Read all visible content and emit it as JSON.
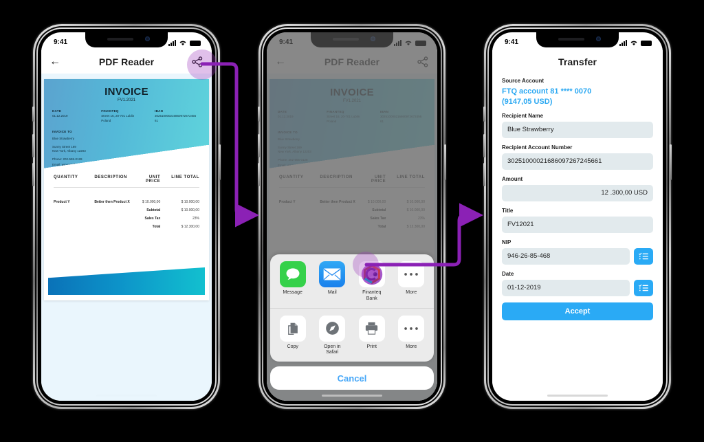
{
  "meta": {
    "accent_purple": "#8b21b5",
    "ios_blue": "#2aaaf5",
    "link_blue": "#48a8f8"
  },
  "status_bar": {
    "time": "9:41",
    "signal_icon": "cellular-bars-icon",
    "wifi_icon": "wifi-icon",
    "battery_icon": "battery-full-icon"
  },
  "phone1": {
    "navbar": {
      "back_icon": "back-arrow-icon",
      "title": "PDF Reader",
      "share_icon": "share-icon"
    },
    "invoice": {
      "title": "INVOICE",
      "number": "FV1.2021",
      "fields": [
        {
          "label": "DATE",
          "value": "01.12.2019"
        },
        {
          "label": "FINANTEQ",
          "value": "Street 16, 20-701 Lublin\nPoland"
        },
        {
          "label": "IBAN",
          "value": "30251000021686097267245661"
        }
      ],
      "invoice_to_label": "INVOICE TO",
      "invoice_to": "Blue Strawberry",
      "address": "Sunny Street 169\nNew York, Albany 12203",
      "phone": "Phone: 202-555-0128",
      "email": "Email: wmonet@ryumail.woo",
      "table_headers": [
        "QUANTITY",
        "DESCRIPTION",
        "UNIT PRICE",
        "LINE TOTAL"
      ],
      "table_row": {
        "quantity": "Product Y",
        "description": "Better then Product X",
        "unit_price": "$ 10.000,00",
        "line_total": "$ 10.000,00"
      },
      "summary": [
        {
          "label": "Subtotal",
          "value": "$ 10.000,00"
        },
        {
          "label": "Sales Tax",
          "value": "23%"
        },
        {
          "label": "Total",
          "value": "$ 12.300,00"
        }
      ]
    }
  },
  "phone2": {
    "navbar": {
      "back_icon": "back-arrow-icon",
      "title": "PDF Reader",
      "share_icon": "share-icon"
    },
    "share_sheet": {
      "apps": [
        {
          "label": "Message",
          "icon": "message-bubble-icon"
        },
        {
          "label": "Mail",
          "icon": "mail-envelope-icon"
        },
        {
          "label": "Finanteq\nBank",
          "icon": "finanteq-bank-icon"
        },
        {
          "label": "More",
          "icon": "more-dots-icon"
        }
      ],
      "actions": [
        {
          "label": "Copy",
          "icon": "copy-pages-icon"
        },
        {
          "label": "Open in\nSafari",
          "icon": "safari-compass-icon"
        },
        {
          "label": "Print",
          "icon": "printer-icon"
        },
        {
          "label": "More",
          "icon": "more-dots-icon"
        }
      ],
      "cancel_label": "Cancel"
    }
  },
  "phone3": {
    "navbar": {
      "title": "Transfer"
    },
    "form": {
      "source_account_label": "Source Account",
      "source_account_line1": "FTQ account 81 **** 0070",
      "source_account_line2": "(9147,05 USD)",
      "recipient_name_label": "Recipient Name",
      "recipient_name_value": "Blue Strawberry",
      "recipient_account_label": "Recipient Account Number",
      "recipient_account_value": "30251000021686097267245661",
      "amount_label": "Amount",
      "amount_value": "12 .300,00 USD",
      "title_label": "Title",
      "title_value": "FV12021",
      "nip_label": "NIP",
      "nip_value": "946-26-85-468",
      "nip_picker_icon": "list-picker-icon",
      "date_label": "Date",
      "date_value": "01-12-2019",
      "date_picker_icon": "list-picker-icon",
      "accept_label": "Accept"
    }
  },
  "annotations": {
    "arrow1": "share-button-to-phone2-arrow",
    "arrow2": "finanteq-bank-to-phone3-arrow",
    "highlight1": "share-button-highlight",
    "highlight2": "finanteq-bank-highlight"
  }
}
